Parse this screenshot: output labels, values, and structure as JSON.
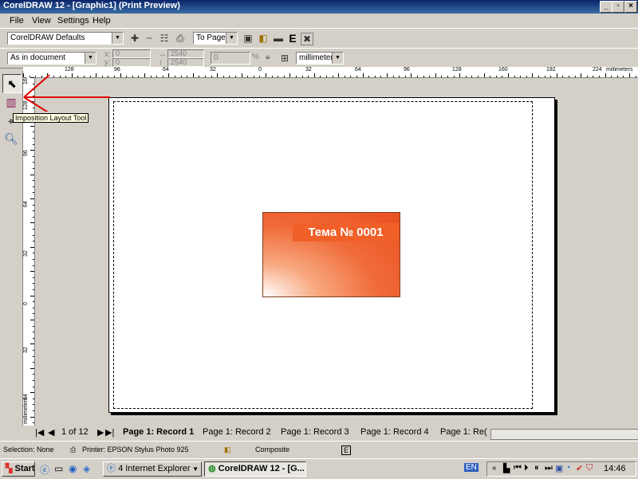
{
  "window": {
    "title": "CorelDRAW 12 - [Graphic1] (Print Preview)",
    "buttons": {
      "minimize": "_",
      "restore": "▫",
      "close": "×"
    }
  },
  "menu": {
    "file": "File",
    "view": "View",
    "settings": "Settings",
    "help": "Help"
  },
  "toolbar1": {
    "preset": "CorelDRAW Defaults",
    "fit": "To Page",
    "e_button": "E"
  },
  "toolbar2": {
    "position_mode": "As in document",
    "x_label": "x:",
    "y_label": "y:",
    "x_value": "0",
    "y_value": "0",
    "w_value": "2540",
    "h_value": "2540",
    "scale_value": "0",
    "percent": "%",
    "units": "millimeters"
  },
  "ruler": {
    "h_labels": [
      "128",
      "96",
      "64",
      "32",
      "0",
      "32",
      "64",
      "96",
      "128",
      "160",
      "192",
      "224"
    ],
    "h_units": "millimeters",
    "v_labels": [
      "160",
      "128",
      "96",
      "64",
      "32",
      "0",
      "32",
      "64"
    ],
    "v_units": "millimeters"
  },
  "tooltip": "Imposition Layout Tool",
  "graphic": {
    "title": "Тема № 0001"
  },
  "pages": {
    "counter": "1 of 12",
    "tabs": [
      "Page 1: Record 1",
      "Page 1: Record 2",
      "Page 1: Record 3",
      "Page 1: Record 4",
      "Page 1: Re("
    ]
  },
  "status": {
    "selection": "Selection: None",
    "printer": "Printer: EPSON Stylus Photo 925",
    "mode": "Composite"
  },
  "taskbar": {
    "start": "Start",
    "ie": "4 Internet Explorer",
    "corel": "CorelDRAW 12 - [G...",
    "lang": "EN",
    "clock": "14:46"
  },
  "colors": {
    "accent": "#0a246a",
    "graphic": "#f06028",
    "annotation": "#e00000"
  }
}
